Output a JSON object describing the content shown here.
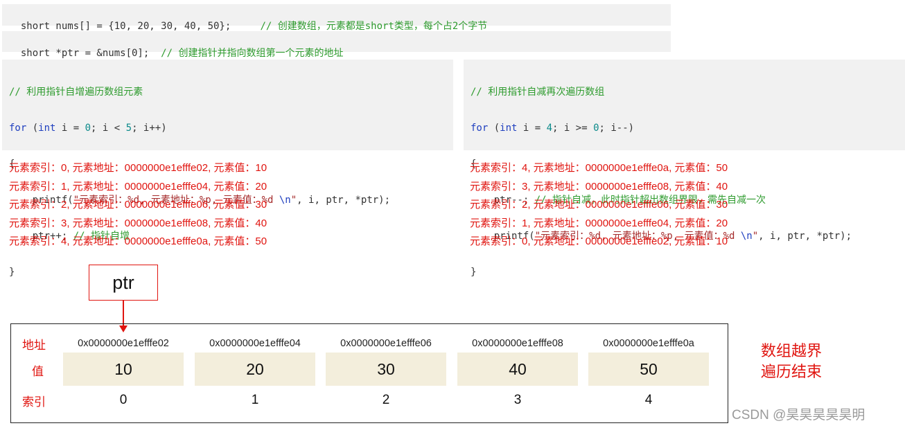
{
  "code_line1": {
    "decl": "short nums[] = {10, 20, 30, 40, 50};",
    "comment": "// 创建数组，元素都是short类型，每个占2个字节"
  },
  "code_line2": {
    "decl": "short *ptr = &nums[0];",
    "comment": "// 创建指针并指向数组第一个元素的地址"
  },
  "loop_left": {
    "comment": "// 利用指针自增遍历数组元素",
    "for_kw": "for",
    "for_open": " (",
    "int_kw": "int",
    "for_mid1": " i = ",
    "init": "0",
    "for_mid2": "; i < ",
    "limit": "5",
    "for_end": "; i++)",
    "brace_open": "{",
    "printf_pre": "    printf(",
    "printf_fmt": "\"元素索引：%d, 元素地址：%p, 元素值：%d ",
    "printf_nl": "\\n",
    "printf_q": "\"",
    "printf_args": ", i, ptr, *ptr);",
    "inc_stmt": "    ptr++; ",
    "inc_comment": "// 指针自增",
    "brace_close": "}"
  },
  "loop_right": {
    "comment": "// 利用指针自减再次遍历数组",
    "for_kw": "for",
    "for_open": " (",
    "int_kw": "int",
    "for_mid1": " i = ",
    "init": "4",
    "for_mid2": "; i >= ",
    "limit": "0",
    "for_end": "; i--)",
    "brace_open": "{",
    "dec_stmt": "    ptr--; ",
    "dec_comment": "// 指针自减，此时指针超出数组界限，需先自减一次",
    "printf_pre": "    printf(",
    "printf_fmt": "\"元素索引：%d, 元素地址：%p, 元素值：%d ",
    "printf_nl": "\\n",
    "printf_q": "\"",
    "printf_args": ", i, ptr, *ptr);",
    "brace_close": "}"
  },
  "output_left": [
    "元素索引：0, 元素地址：0000000e1efffe02, 元素值：10",
    "元素索引：1, 元素地址：0000000e1efffe04, 元素值：20",
    "元素索引：2, 元素地址：0000000e1efffe06, 元素值：30",
    "元素索引：3, 元素地址：0000000e1efffe08, 元素值：40",
    "元素索引：4, 元素地址：0000000e1efffe0a, 元素值：50"
  ],
  "output_right": [
    "元素索引：4, 元素地址：0000000e1efffe0a, 元素值：50",
    "元素索引：3, 元素地址：0000000e1efffe08, 元素值：40",
    "元素索引：2, 元素地址：0000000e1efffe06, 元素值：30",
    "元素索引：1, 元素地址：0000000e1efffe04, 元素值：20",
    "元素索引：0, 元素地址：0000000e1efffe02, 元素值：10"
  ],
  "diagram": {
    "pointer_label": "ptr",
    "row_labels": {
      "address": "地址",
      "value": "值",
      "index": "索引"
    },
    "cells": [
      {
        "address": "0x0000000e1efffe02",
        "value": "10",
        "index": "0"
      },
      {
        "address": "0x0000000e1efffe04",
        "value": "20",
        "index": "1"
      },
      {
        "address": "0x0000000e1efffe06",
        "value": "30",
        "index": "2"
      },
      {
        "address": "0x0000000e1efffe08",
        "value": "40",
        "index": "3"
      },
      {
        "address": "0x0000000e1efffe0a",
        "value": "50",
        "index": "4"
      }
    ],
    "note_line1": "数组越界",
    "note_line2": "遍历结束"
  },
  "watermark": "CSDN @昊昊昊昊昊明",
  "colors": {
    "accent_red": "#e0140f",
    "code_bg": "#f1f1f1",
    "cell_bg": "#f3eedc",
    "comment_green": "#2e9b2e",
    "keyword_blue": "#1f3fbf"
  }
}
